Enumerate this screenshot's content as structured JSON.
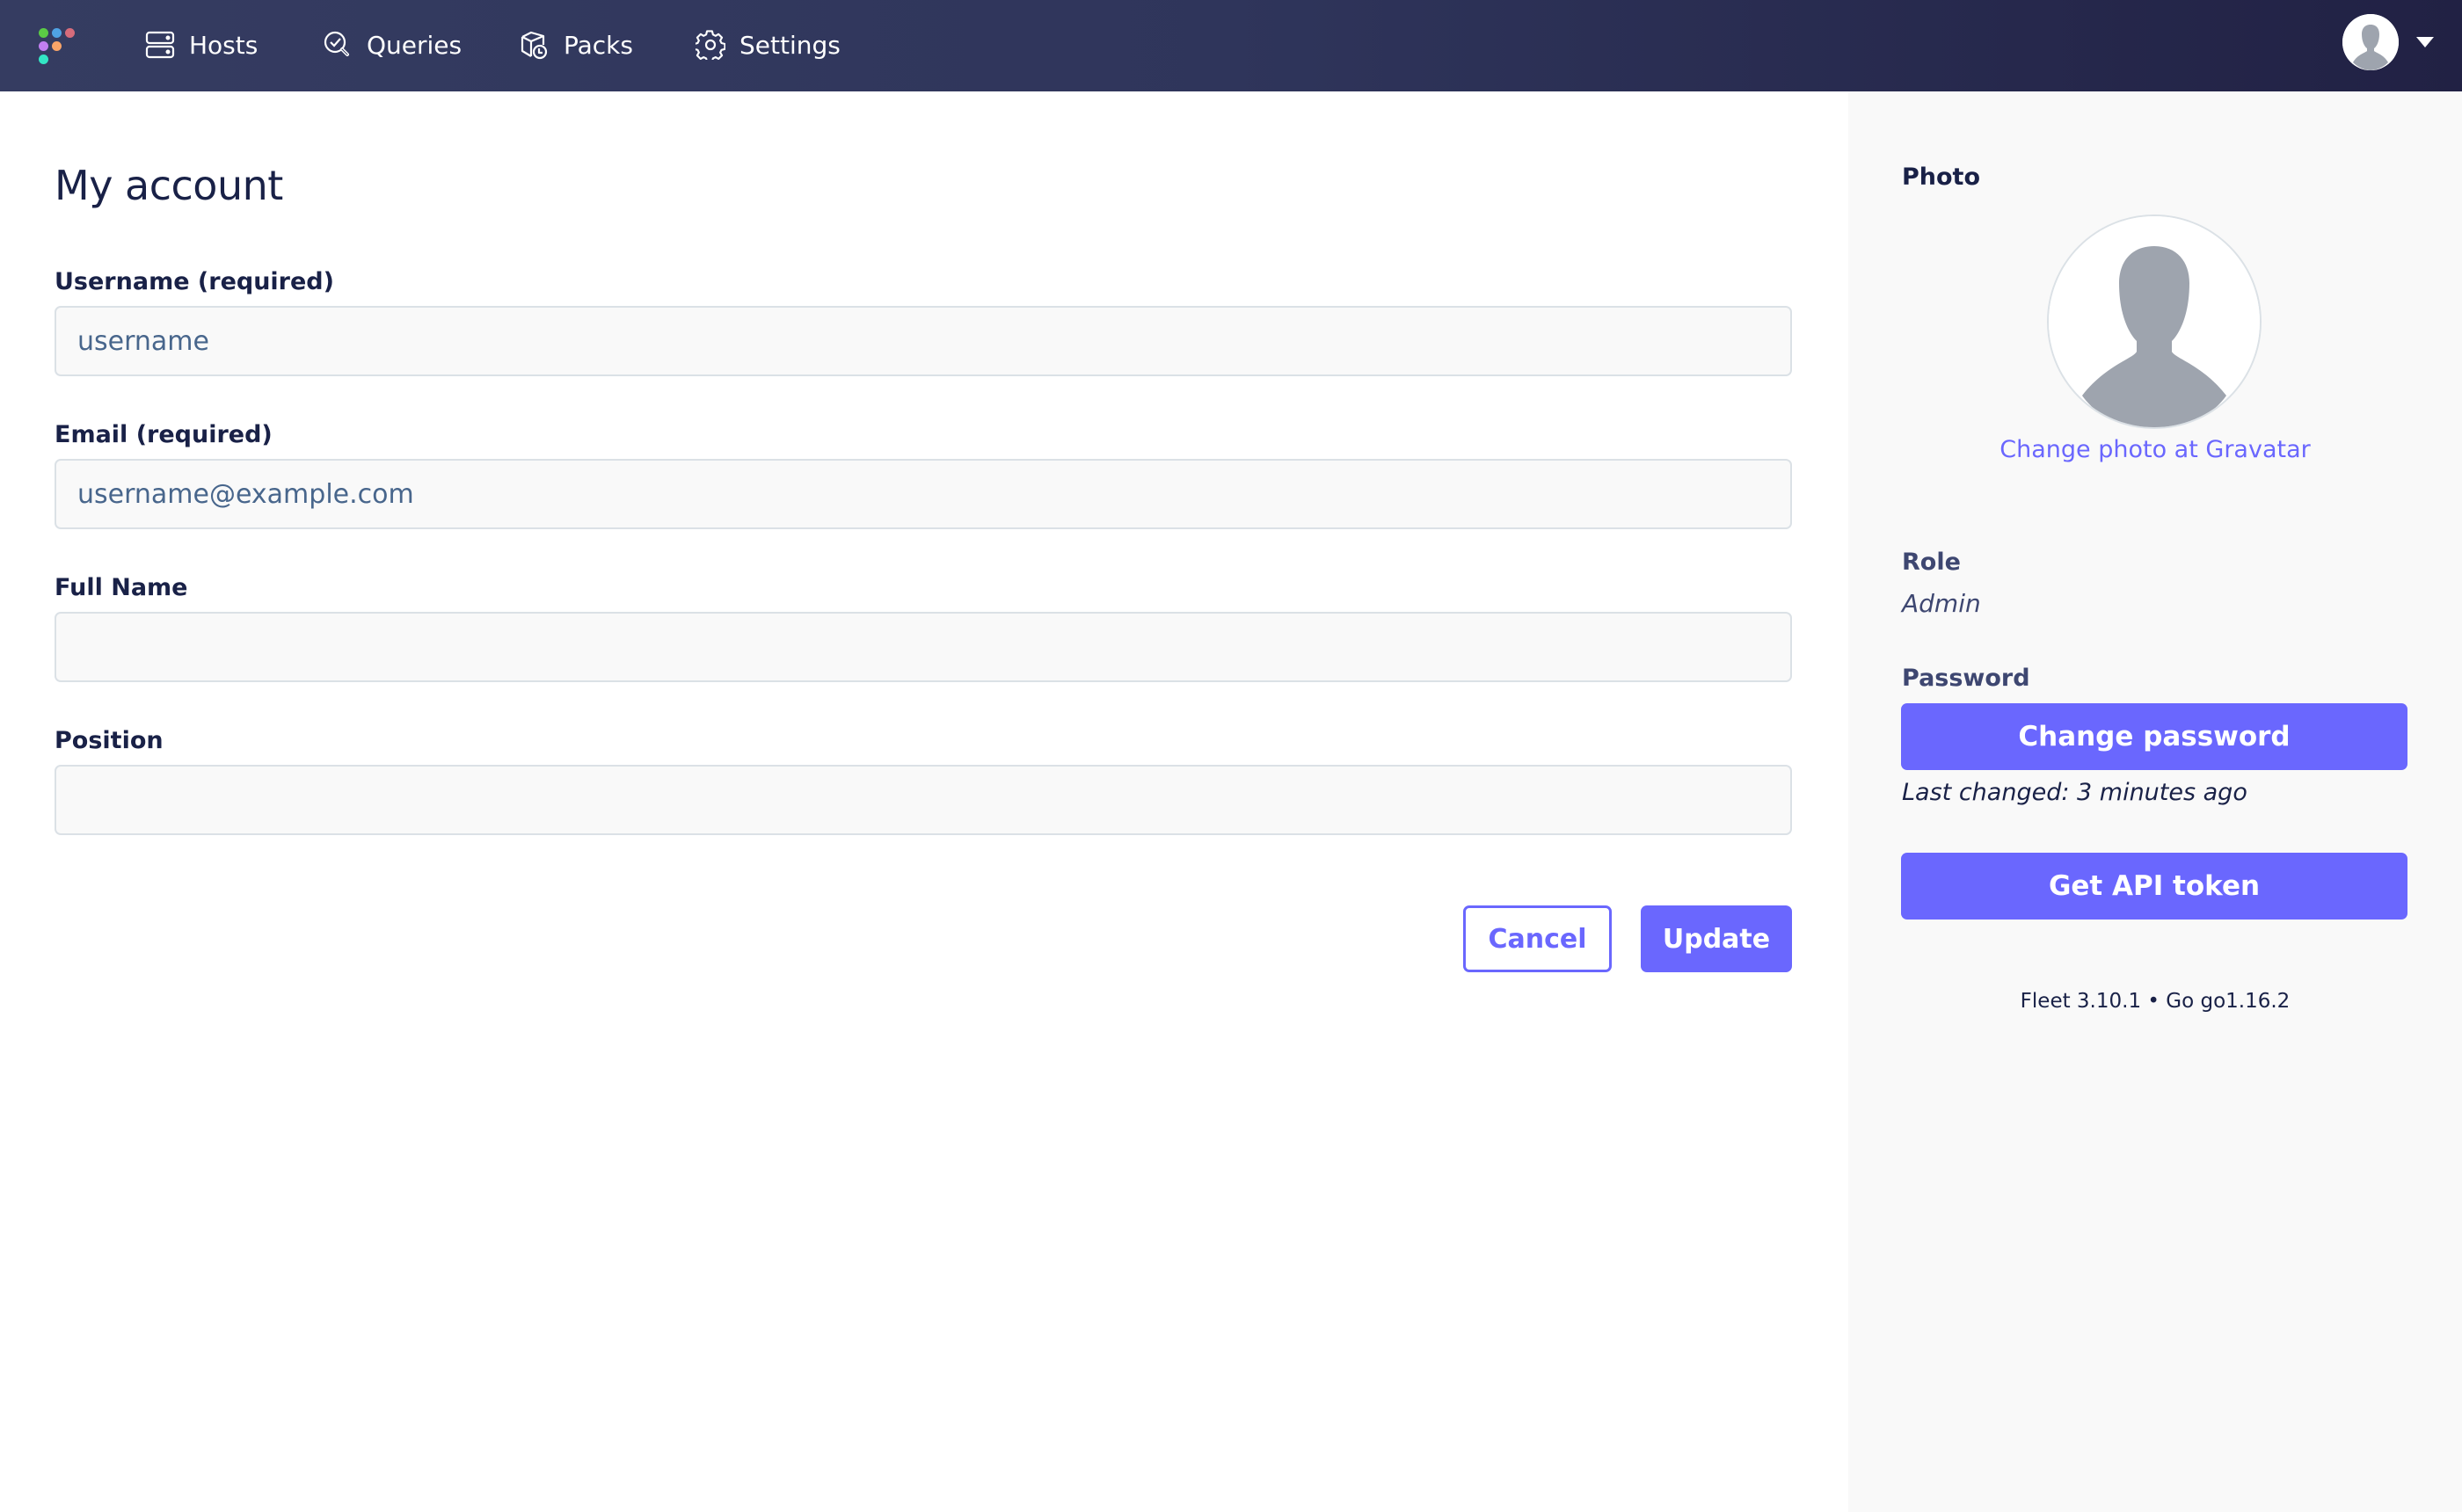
{
  "nav": {
    "logo_dot_colors": [
      "#5bcb45",
      "#4fa3e4",
      "#d66c7b",
      "#c27ff1",
      "#f9a468",
      "#33e6c5"
    ],
    "items": [
      {
        "label": "Hosts",
        "icon": "hosts-icon"
      },
      {
        "label": "Queries",
        "icon": "queries-icon"
      },
      {
        "label": "Packs",
        "icon": "packs-icon"
      },
      {
        "label": "Settings",
        "icon": "settings-icon"
      }
    ],
    "user_menu": {
      "icon": "user-avatar-icon",
      "caret_icon": "caret-down-icon"
    }
  },
  "page": {
    "title": "My account",
    "fields": [
      {
        "label": "Username (required)",
        "value": "username",
        "placeholder": ""
      },
      {
        "label": "Email (required)",
        "value": "username@example.com",
        "placeholder": ""
      },
      {
        "label": "Full Name",
        "value": "",
        "placeholder": ""
      },
      {
        "label": "Position",
        "value": "",
        "placeholder": ""
      }
    ],
    "cancel_label": "Cancel",
    "update_label": "Update"
  },
  "sidebar": {
    "photo_label": "Photo",
    "gravatar_link": "Change photo at Gravatar",
    "role_label": "Role",
    "role_value": "Admin",
    "password_label": "Password",
    "change_password_label": "Change password",
    "last_changed": "Last changed: 3 minutes ago",
    "api_token_label": "Get API token",
    "version": "Fleet 3.10.1 • Go go1.16.2"
  },
  "colors": {
    "accent": "#6a67fe",
    "text": "#192147",
    "nav_bg_start": "#353c61",
    "nav_bg_end": "#212144",
    "sidebar_bg": "#f9f9f9"
  }
}
